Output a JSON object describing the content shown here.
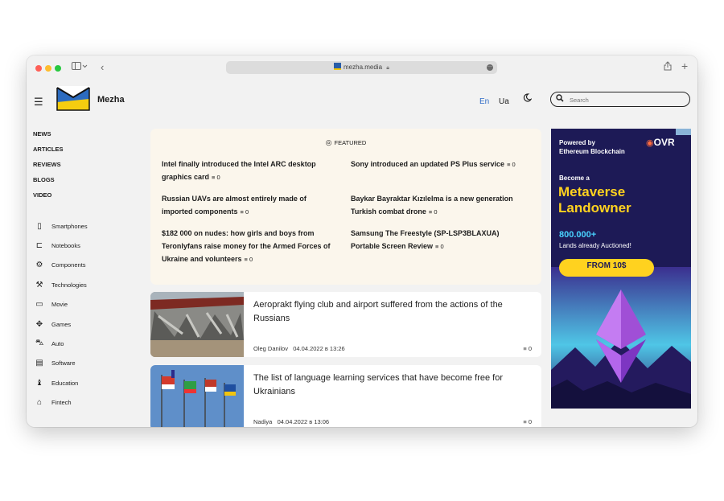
{
  "browser": {
    "url": "mezha.media",
    "sidebar_toggle_icon": "sidebar-icon",
    "back_icon": "chevron-left-icon"
  },
  "header": {
    "brand": "Mezha",
    "languages": [
      "En",
      "Ua"
    ],
    "active_language": "En",
    "search_placeholder": "Search",
    "accent_color": "#2f6cc7"
  },
  "nav": {
    "primary": [
      "NEWS",
      "ARTICLES",
      "REVIEWS",
      "BLOGS",
      "VIDEO"
    ],
    "categories": [
      {
        "label": "Smartphones",
        "icon": "smartphone-icon"
      },
      {
        "label": "Notebooks",
        "icon": "laptop-icon"
      },
      {
        "label": "Components",
        "icon": "chip-icon"
      },
      {
        "label": "Technologies",
        "icon": "robot-arm-icon"
      },
      {
        "label": "Movie",
        "icon": "clapperboard-icon"
      },
      {
        "label": "Games",
        "icon": "gamepad-icon"
      },
      {
        "label": "Auto",
        "icon": "car-icon"
      },
      {
        "label": "Software",
        "icon": "window-icon"
      },
      {
        "label": "Education",
        "icon": "graduation-icon"
      },
      {
        "label": "Fintech",
        "icon": "bank-icon"
      }
    ]
  },
  "featured": {
    "heading": "FEATURED",
    "items": [
      {
        "title": "Intel finally introduced the Intel ARC desktop graphics card",
        "comments": "0"
      },
      {
        "title": "Sony introduced an updated PS Plus service",
        "comments": "0"
      },
      {
        "title": "Russian UAVs are almost entirely made of imported components",
        "comments": "0"
      },
      {
        "title": "Baykar Bayraktar Kızılelma is a new generation Turkish combat drone",
        "comments": "0"
      },
      {
        "title": "$182 000 on nudes: how girls and boys from Teronlyfans raise money for the Armed Forces of Ukraine and volunteers",
        "comments": "0"
      },
      {
        "title": "Samsung The Freestyle (SP-LSP3BLAXUA) Portable Screen Review",
        "comments": "0"
      }
    ]
  },
  "articles": [
    {
      "title": "Aeroprakt flying club and airport suffered from the actions of the Russians",
      "author": "Oleg Danilov",
      "date": "04.04.2022 в 13:26",
      "comments": "0"
    },
    {
      "title": "The list of language learning services that have become free for Ukrainians",
      "author": "Nadiya",
      "date": "04.04.2022 в 13:06",
      "comments": "0"
    }
  ],
  "ad": {
    "powered": "Powered by",
    "chain": "Ethereum Blockchain",
    "logo": "OVR",
    "become": "Become a",
    "headline1": "Metaverse",
    "headline2": "Landowner",
    "count": "800.000+",
    "sub": "Lands already Auctioned!",
    "cta": "FROM 10$",
    "headline_color": "#ffd21f"
  }
}
